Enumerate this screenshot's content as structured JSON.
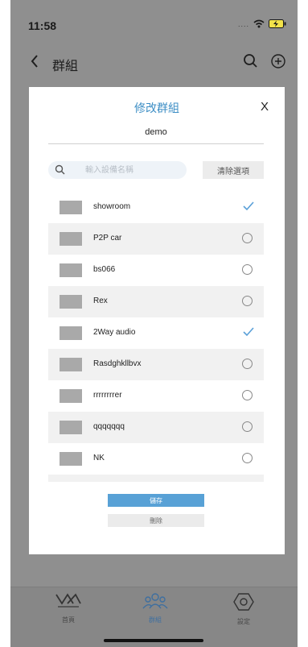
{
  "status_bar": {
    "time": "11:58",
    "signal_dots": "....",
    "icons": [
      "wifi-icon",
      "battery-charging-icon"
    ]
  },
  "nav": {
    "back_icon": "chevron-left-icon",
    "title": "群組",
    "search_icon": "search-icon",
    "add_icon": "plus-circle-icon"
  },
  "modal": {
    "title": "修改群組",
    "close_label": "X",
    "group_name_value": "demo",
    "search": {
      "placeholder": "輸入設備名稱",
      "value": ""
    },
    "clear_label": "清除選項",
    "devices": [
      {
        "label": "showroom",
        "selected": true
      },
      {
        "label": "P2P car",
        "selected": false
      },
      {
        "label": "bs066",
        "selected": false
      },
      {
        "label": "Rex",
        "selected": false
      },
      {
        "label": "2Way audio",
        "selected": true
      },
      {
        "label": "Rasdghkllbvx",
        "selected": false
      },
      {
        "label": "rrrrrrrrer",
        "selected": false
      },
      {
        "label": "qqqqqqq",
        "selected": false
      },
      {
        "label": "NK",
        "selected": false
      }
    ],
    "save_label": "儲存",
    "delete_label": "刪除"
  },
  "tabbar": {
    "items": [
      {
        "label": "首頁",
        "icon": "vacron-logo-icon",
        "active": false
      },
      {
        "label": "群組",
        "icon": "group-people-icon",
        "active": true
      },
      {
        "label": "設定",
        "icon": "settings-hexagon-icon",
        "active": false
      }
    ]
  },
  "colors": {
    "accent": "#3d8ec5",
    "save_button": "#58a1d6",
    "overlay": "#8f8f8f",
    "checkmark": "#5aa0d8"
  }
}
